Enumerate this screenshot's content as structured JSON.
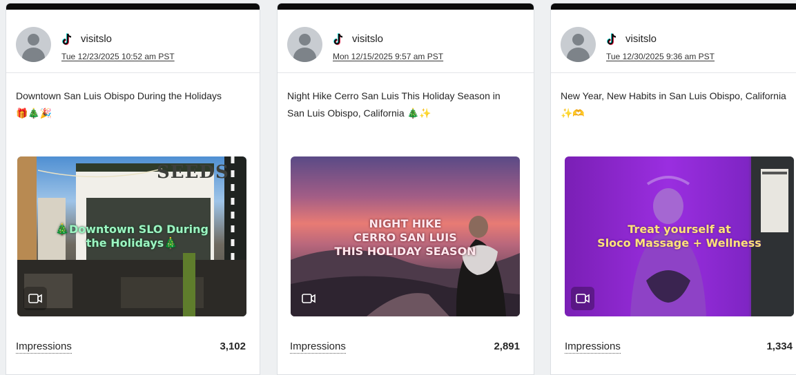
{
  "cards": [
    {
      "account": "visitslo",
      "date": "Tue 12/23/2025 10:52 am PST",
      "caption": "Downtown San Luis Obispo During the Holidays 🎁🎄🎉",
      "thumbnail": {
        "sign": "SEEDS",
        "overlay_lines": [
          "🎄Downtown SLO During",
          "the Holidays🎄"
        ],
        "overlay_color": "#9cf5c2"
      },
      "metric_label": "Impressions",
      "metric_value": "3,102"
    },
    {
      "account": "visitslo",
      "date": "Mon 12/15/2025 9:57 am PST",
      "caption": "Night Hike Cerro San Luis This Holiday Season in San Luis Obispo, California 🎄✨",
      "thumbnail": {
        "overlay_lines": [
          "NIGHT HIKE",
          "CERRO SAN LUIS",
          "THIS HOLIDAY SEASON"
        ],
        "overlay_color": "#ffe8ee"
      },
      "metric_label": "Impressions",
      "metric_value": "2,891"
    },
    {
      "account": "visitslo",
      "date": "Tue 12/30/2025 9:36 am PST",
      "caption": "New Year, New Habits in San Luis Obispo, California ✨🫶",
      "thumbnail": {
        "overlay_lines": [
          "Treat yourself at",
          "Sloco Massage + Wellness"
        ],
        "overlay_color": "#ffe27a"
      },
      "metric_label": "Impressions",
      "metric_value": "1,334"
    }
  ],
  "colors": {
    "tiktok_cyan": "#25f4ee",
    "tiktok_red": "#fe2c55",
    "brand_black": "#0b0b0b"
  }
}
